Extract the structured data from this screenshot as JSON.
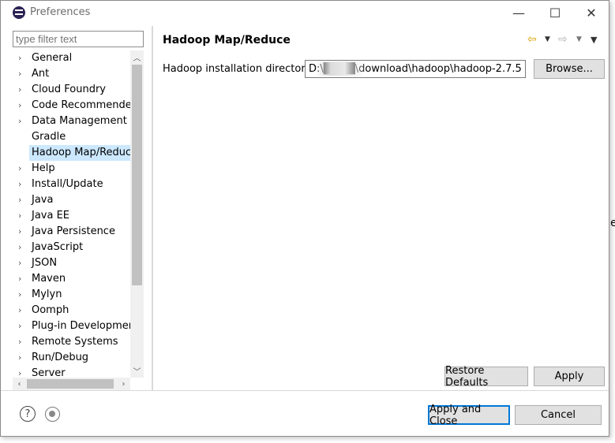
{
  "window": {
    "title": "Preferences",
    "minimize": "—",
    "maximize": "☐",
    "close": "✕"
  },
  "filter": {
    "placeholder": "type filter text"
  },
  "tree": {
    "items": [
      {
        "label": "General",
        "expandable": true
      },
      {
        "label": "Ant",
        "expandable": true
      },
      {
        "label": "Cloud Foundry",
        "expandable": true
      },
      {
        "label": "Code Recommenders",
        "expandable": true
      },
      {
        "label": "Data Management",
        "expandable": true
      },
      {
        "label": "Gradle",
        "expandable": false
      },
      {
        "label": "Hadoop Map/Reduce",
        "expandable": false,
        "selected": true
      },
      {
        "label": "Help",
        "expandable": true
      },
      {
        "label": "Install/Update",
        "expandable": true
      },
      {
        "label": "Java",
        "expandable": true
      },
      {
        "label": "Java EE",
        "expandable": true
      },
      {
        "label": "Java Persistence",
        "expandable": true
      },
      {
        "label": "JavaScript",
        "expandable": true
      },
      {
        "label": "JSON",
        "expandable": true
      },
      {
        "label": "Maven",
        "expandable": true
      },
      {
        "label": "Mylyn",
        "expandable": true
      },
      {
        "label": "Oomph",
        "expandable": true
      },
      {
        "label": "Plug-in Development",
        "expandable": true
      },
      {
        "label": "Remote Systems",
        "expandable": true
      },
      {
        "label": "Run/Debug",
        "expandable": true
      },
      {
        "label": "Server",
        "expandable": true
      }
    ]
  },
  "page": {
    "title": "Hadoop Map/Reduce",
    "field_label": "Hadoop installation directory:",
    "field_value": "D:\\████\\download\\hadoop\\hadoop-2.7.5",
    "browse_label": "Browse...",
    "restore_label": "Restore Defaults",
    "apply_label": "Apply"
  },
  "footer": {
    "help": "?",
    "apply_close_label": "Apply and Close",
    "cancel_label": "Cancel"
  },
  "colors": {
    "selection": "#cce8ff",
    "nav_back": "#e0a000",
    "primary_border": "#0078d7"
  }
}
